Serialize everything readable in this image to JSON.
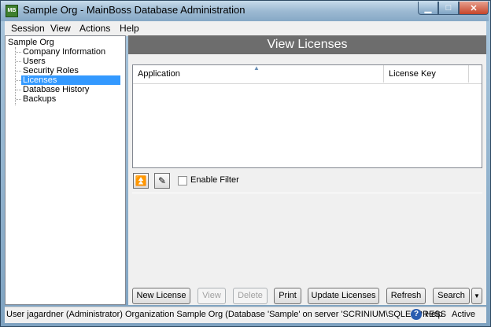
{
  "window": {
    "title": "Sample Org - MainBoss Database Administration",
    "icon_label": "MB"
  },
  "menubar": {
    "items": [
      "Session",
      "View",
      "Actions",
      "Help"
    ]
  },
  "tree": {
    "root": "Sample Org",
    "children": [
      "Company Information",
      "Users",
      "Security Roles",
      "Licenses",
      "Database History",
      "Backups"
    ],
    "selected": "Licenses"
  },
  "content": {
    "header": "View Licenses",
    "grid": {
      "columns": [
        "Application",
        "License Key"
      ],
      "rows": []
    },
    "filter": {
      "enable_label": "Enable Filter",
      "checked": false
    },
    "buttons": {
      "new": "New License",
      "view": "View",
      "delete": "Delete",
      "print": "Print",
      "update": "Update Licenses",
      "refresh": "Refresh",
      "search": "Search"
    }
  },
  "statusbar": {
    "text": "User jagardner (Administrator) Organization Sample Org (Database 'Sample' on server 'SCRINIUM\\SQLEXPRESS",
    "help": "Help",
    "state": "Active"
  },
  "colors": {
    "header_bg": "#6d6d6d",
    "selection": "#3399ff"
  },
  "icons": [
    "minimize-icon",
    "maximize-icon",
    "close-icon",
    "collapse-panel-icon",
    "edit-filter-icon",
    "help-icon",
    "dropdown-arrow-icon"
  ]
}
